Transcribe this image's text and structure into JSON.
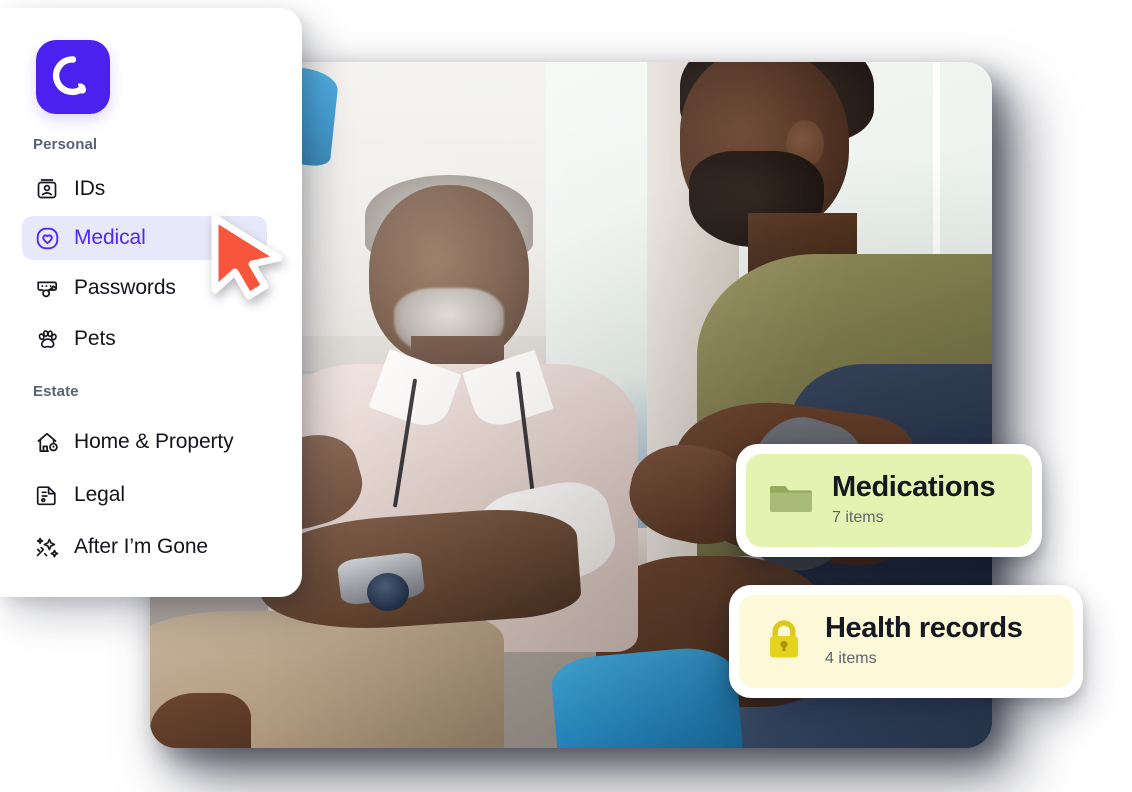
{
  "app": {
    "logo_icon": "quikkly-q-logo-icon",
    "brand_color": "#4b21f0"
  },
  "sidebar": {
    "sections": [
      {
        "label": "Personal",
        "items": [
          {
            "label": "IDs",
            "icon": "id-card-icon",
            "active": false
          },
          {
            "label": "Medical",
            "icon": "heart-shield-icon",
            "active": true
          },
          {
            "label": "Passwords",
            "icon": "password-key-icon",
            "active": false
          },
          {
            "label": "Pets",
            "icon": "paw-print-icon",
            "active": false
          }
        ]
      },
      {
        "label": "Estate",
        "items": [
          {
            "label": "Home & Property",
            "icon": "house-pin-icon",
            "active": false
          },
          {
            "label": "Legal",
            "icon": "legal-document-icon",
            "active": false
          },
          {
            "label": "After I’m Gone",
            "icon": "sparkle-star-icon",
            "active": false
          }
        ]
      }
    ],
    "active_item_bg": "#e7e8f9",
    "active_item_color": "#5227f0",
    "section_label_color": "#5a6372"
  },
  "cursor": {
    "icon": "arrow-pointer-cursor",
    "color": "#f8563c"
  },
  "photo": {
    "alt": "Older doctor with stethoscope talking to a seated patient whose leg is wrapped in a blue cast",
    "name": "clinic-consultation-photo"
  },
  "cards": [
    {
      "title": "Medications",
      "subtitle": "7 items",
      "icon": "folder-icon",
      "icon_color": "#8fa758",
      "background": "#e4f2b2"
    },
    {
      "title": "Health records",
      "subtitle": "4 items",
      "icon": "lock-icon",
      "icon_color": "#e0d01e",
      "background": "#fcf8d8"
    }
  ]
}
